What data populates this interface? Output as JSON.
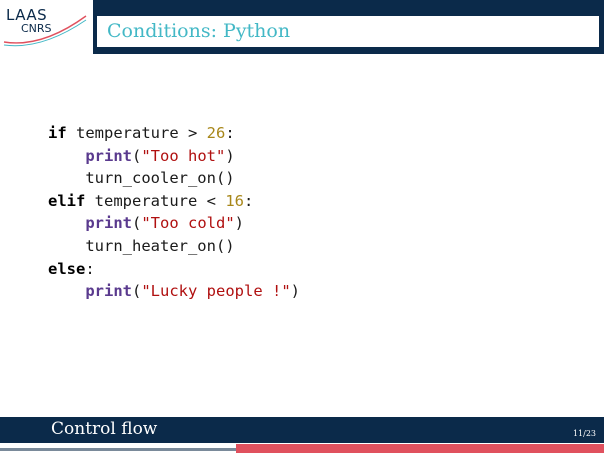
{
  "logo": {
    "top": "LAAS",
    "bottom": "CNRS"
  },
  "header": {
    "title": "Conditions: Python"
  },
  "code": {
    "lines": [
      [
        {
          "t": "kw",
          "v": "if"
        },
        {
          "t": "txt",
          "v": " temperature > "
        },
        {
          "t": "num",
          "v": "26"
        },
        {
          "t": "txt",
          "v": ":"
        }
      ],
      [
        {
          "t": "txt",
          "v": "    "
        },
        {
          "t": "fn",
          "v": "print"
        },
        {
          "t": "txt",
          "v": "("
        },
        {
          "t": "str",
          "v": "\"Too hot\""
        },
        {
          "t": "txt",
          "v": ")"
        }
      ],
      [
        {
          "t": "txt",
          "v": "    turn_cooler_on()"
        }
      ],
      [
        {
          "t": "kw",
          "v": "elif"
        },
        {
          "t": "txt",
          "v": " temperature < "
        },
        {
          "t": "num",
          "v": "16"
        },
        {
          "t": "txt",
          "v": ":"
        }
      ],
      [
        {
          "t": "txt",
          "v": "    "
        },
        {
          "t": "fn",
          "v": "print"
        },
        {
          "t": "txt",
          "v": "("
        },
        {
          "t": "str",
          "v": "\"Too cold\""
        },
        {
          "t": "txt",
          "v": ")"
        }
      ],
      [
        {
          "t": "txt",
          "v": "    turn_heater_on()"
        }
      ],
      [
        {
          "t": "kw",
          "v": "else"
        },
        {
          "t": "txt",
          "v": ":"
        }
      ],
      [
        {
          "t": "txt",
          "v": "    "
        },
        {
          "t": "fn",
          "v": "print"
        },
        {
          "t": "txt",
          "v": "("
        },
        {
          "t": "str",
          "v": "\"Lucky people !\""
        },
        {
          "t": "txt",
          "v": ")"
        }
      ]
    ]
  },
  "footer": {
    "section": "Control flow",
    "page": "11/23"
  },
  "colors": {
    "primary": "#0b2a4a",
    "title": "#43b8c6",
    "accent": "#e0515e",
    "keyword_fn": "#5a3a8e",
    "number": "#a8871a",
    "string": "#b01010"
  }
}
